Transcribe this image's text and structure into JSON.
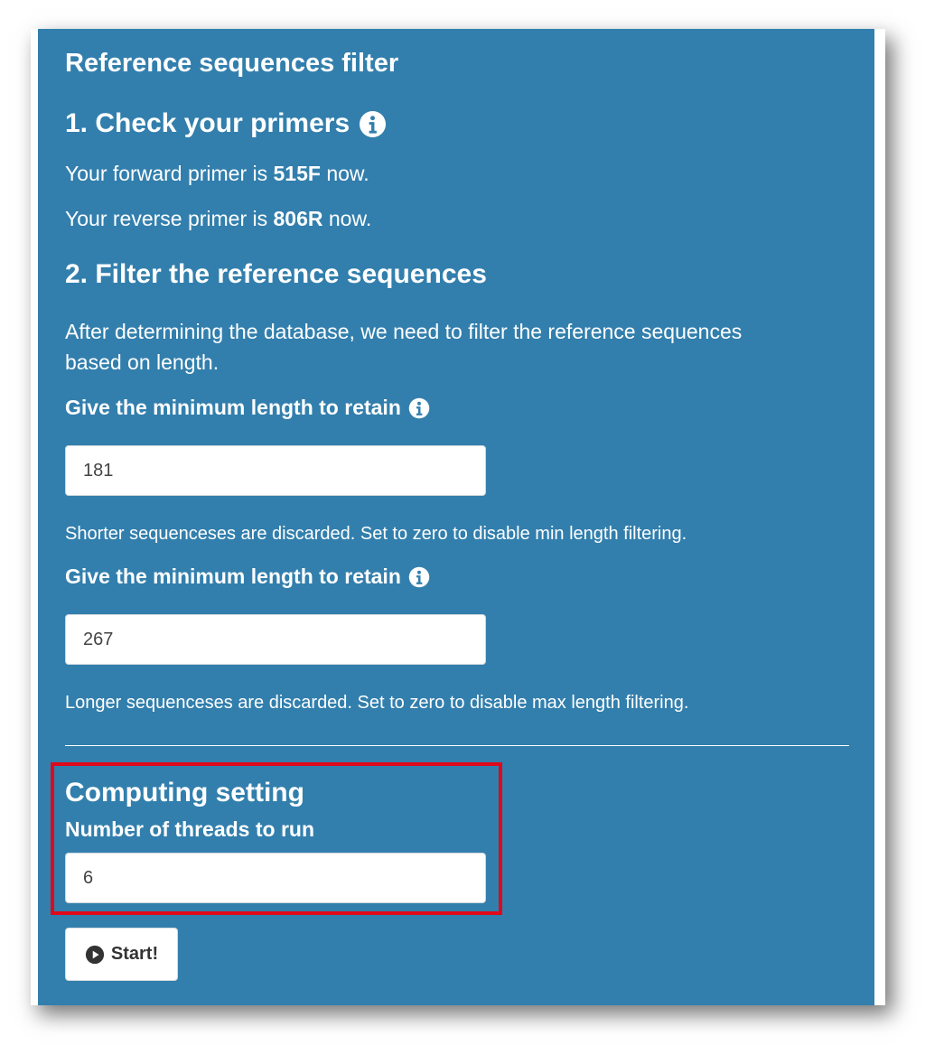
{
  "panel": {
    "title": "Reference sequences filter",
    "section1": {
      "heading": "1. Check your primers",
      "forward_prefix": "Your forward primer is ",
      "forward_value": "515F",
      "forward_suffix": " now.",
      "reverse_prefix": "Your reverse primer is ",
      "reverse_value": "806R",
      "reverse_suffix": " now."
    },
    "section2": {
      "heading": "2. Filter the reference sequences",
      "description_line1": "After determining the database, we need to filter the reference sequences",
      "description_line2": "based on length.",
      "min_label": "Give the minimum length to retain",
      "min_value": "181",
      "min_help": "Shorter sequenceses are discarded. Set to zero to disable min length filtering.",
      "max_label": "Give the minimum length to retain",
      "max_value": "267",
      "max_help": "Longer sequenceses are discarded. Set to zero to disable max length filtering."
    },
    "computing": {
      "heading": "Computing setting",
      "threads_label": "Number of threads to run",
      "threads_value": "6"
    },
    "start_button": "Start!"
  },
  "icons": {
    "info": "info-circle-icon",
    "play": "play-circle-icon"
  },
  "colors": {
    "panel_background": "#327fad",
    "highlight_border": "#e0081a"
  }
}
